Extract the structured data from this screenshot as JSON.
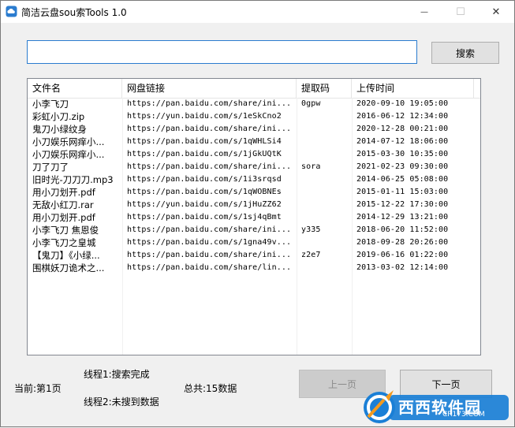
{
  "window": {
    "title": "简洁云盘sou索Tools 1.0",
    "controls": {
      "minimize": "—",
      "maximize": "☐",
      "close": "✕"
    }
  },
  "search": {
    "value": "",
    "placeholder": "",
    "button_label": "搜索"
  },
  "table": {
    "columns": [
      "文件名",
      "网盘链接",
      "提取码",
      "上传时间"
    ],
    "rows": [
      {
        "name": "小李飞刀",
        "link": "https://pan.baidu.com/share/ini...",
        "code": "0gpw",
        "time": "2020-09-10 19:05:00"
      },
      {
        "name": "彩虹小刀.zip",
        "link": "https://yun.baidu.com/s/1eSkCno2",
        "code": "",
        "time": "2016-06-12 12:34:00"
      },
      {
        "name": "鬼刀小绿纹身",
        "link": "https://pan.baidu.com/share/ini...",
        "code": "",
        "time": "2020-12-28 00:21:00"
      },
      {
        "name": "小刀娱乐网痒小...",
        "link": "https://pan.baidu.com/s/1qWHLSi4",
        "code": "",
        "time": "2014-07-12 18:06:00"
      },
      {
        "name": "小刀娱乐网痒小...",
        "link": "https://pan.baidu.com/s/1jGkUQtK",
        "code": "",
        "time": "2015-03-30 10:35:00"
      },
      {
        "name": "刀了刀了",
        "link": "https://pan.baidu.com/share/ini...",
        "code": "sora",
        "time": "2021-02-23 09:30:00"
      },
      {
        "name": "旧时光-刀刀刀.mp3",
        "link": "https://pan.baidu.com/s/1i3srqsd",
        "code": "",
        "time": "2014-06-25 05:08:00"
      },
      {
        "name": "用小刀划开.pdf",
        "link": "https://pan.baidu.com/s/1qWOBNEs",
        "code": "",
        "time": "2015-01-11 15:03:00"
      },
      {
        "name": "无敌小红刀.rar",
        "link": "https://yun.baidu.com/s/1jHuZZ62",
        "code": "",
        "time": "2015-12-22 17:30:00"
      },
      {
        "name": "用小刀划开.pdf",
        "link": "https://pan.baidu.com/s/1sj4qBmt",
        "code": "",
        "time": "2014-12-29 13:21:00"
      },
      {
        "name": "小李飞刀 焦恩俊",
        "link": "https://pan.baidu.com/share/ini...",
        "code": "y335",
        "time": "2018-06-20 11:52:00"
      },
      {
        "name": "小李飞刀之皇城",
        "link": "https://pan.baidu.com/s/1gna49v...",
        "code": "",
        "time": "2018-09-28 20:26:00"
      },
      {
        "name": "【鬼刀】《小绿...",
        "link": "https://pan.baidu.com/share/ini...",
        "code": "z2e7",
        "time": "2019-06-16 01:22:00"
      },
      {
        "name": "围棋妖刀诡术之...",
        "link": "https://pan.baidu.com/share/lin...",
        "code": "",
        "time": "2013-03-02 12:14:00"
      }
    ]
  },
  "status": {
    "current_page": "当前:第1页",
    "thread1": "线程1:搜索完成",
    "thread2": "线程2:未搜到数据",
    "total": "总共:15数据"
  },
  "pager": {
    "prev_label": "上一页",
    "next_label": "下一页"
  },
  "watermark": {
    "text": "西西软件园",
    "domain": "CR173.COM"
  },
  "colors": {
    "accent": "#2b7ccf",
    "window_bg": "#f0f0f0",
    "watermark_blue": "#1a7fd6",
    "watermark_orange": "#f39a1e"
  }
}
